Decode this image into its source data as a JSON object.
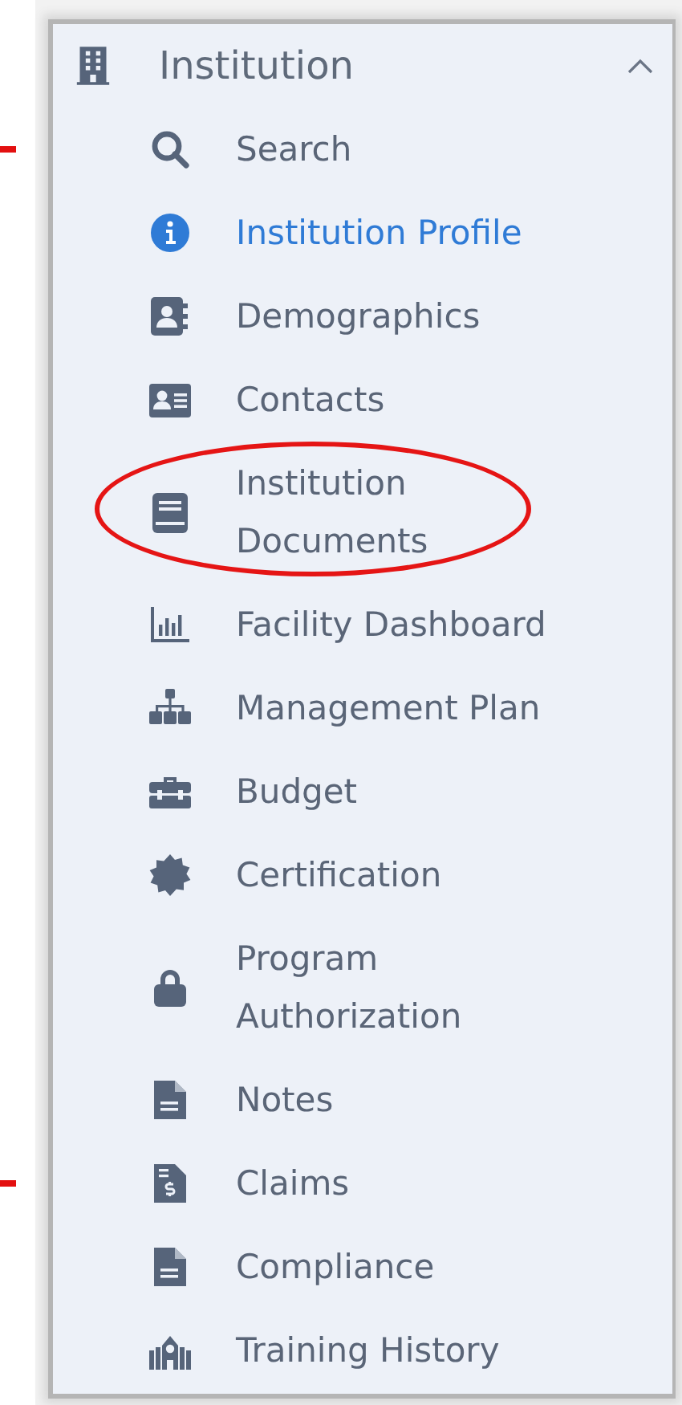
{
  "section": {
    "title": "Institution",
    "expanded": true
  },
  "items": [
    {
      "label": "Search",
      "selected": false,
      "circled": false,
      "marked": true
    },
    {
      "label": "Institution Profile",
      "selected": true,
      "circled": false,
      "marked": false
    },
    {
      "label": "Demographics",
      "selected": false,
      "circled": false,
      "marked": false
    },
    {
      "label": "Contacts",
      "selected": false,
      "circled": false,
      "marked": false
    },
    {
      "label": "Institution Documents",
      "selected": false,
      "circled": true,
      "marked": false
    },
    {
      "label": "Facility Dashboard",
      "selected": false,
      "circled": false,
      "marked": false
    },
    {
      "label": "Management Plan",
      "selected": false,
      "circled": false,
      "marked": false
    },
    {
      "label": "Budget",
      "selected": false,
      "circled": false,
      "marked": false
    },
    {
      "label": "Certification",
      "selected": false,
      "circled": false,
      "marked": false
    },
    {
      "label": "Program Authorization",
      "selected": false,
      "circled": false,
      "marked": false
    },
    {
      "label": "Notes",
      "selected": false,
      "circled": false,
      "marked": false
    },
    {
      "label": "Claims",
      "selected": false,
      "circled": false,
      "marked": true
    },
    {
      "label": "Compliance",
      "selected": false,
      "circled": false,
      "marked": false
    },
    {
      "label": "Training History",
      "selected": false,
      "circled": false,
      "marked": false
    }
  ]
}
